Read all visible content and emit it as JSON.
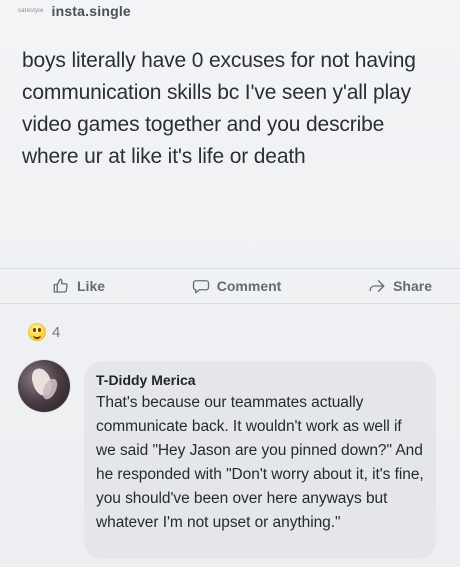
{
  "header": {
    "tiny_mark": "safestyle",
    "handle": "insta.single"
  },
  "post": {
    "text": "boys literally have 0 excuses for not having communication skills bc I've seen y'all play video games together and you describe where ur at like it's life or death"
  },
  "actions": {
    "like_label": "Like",
    "comment_label": "Comment",
    "share_label": "Share"
  },
  "reactions": {
    "count": "4"
  },
  "comment": {
    "author": "T-Diddy Merica",
    "text": "That's because our teammates actually communicate back. It wouldn't work as well if we said \"Hey Jason are you pinned down?\" And he responded with \"Don't worry about it, it's fine, you should've been over here anyways but whatever I'm not upset or anything.\""
  }
}
